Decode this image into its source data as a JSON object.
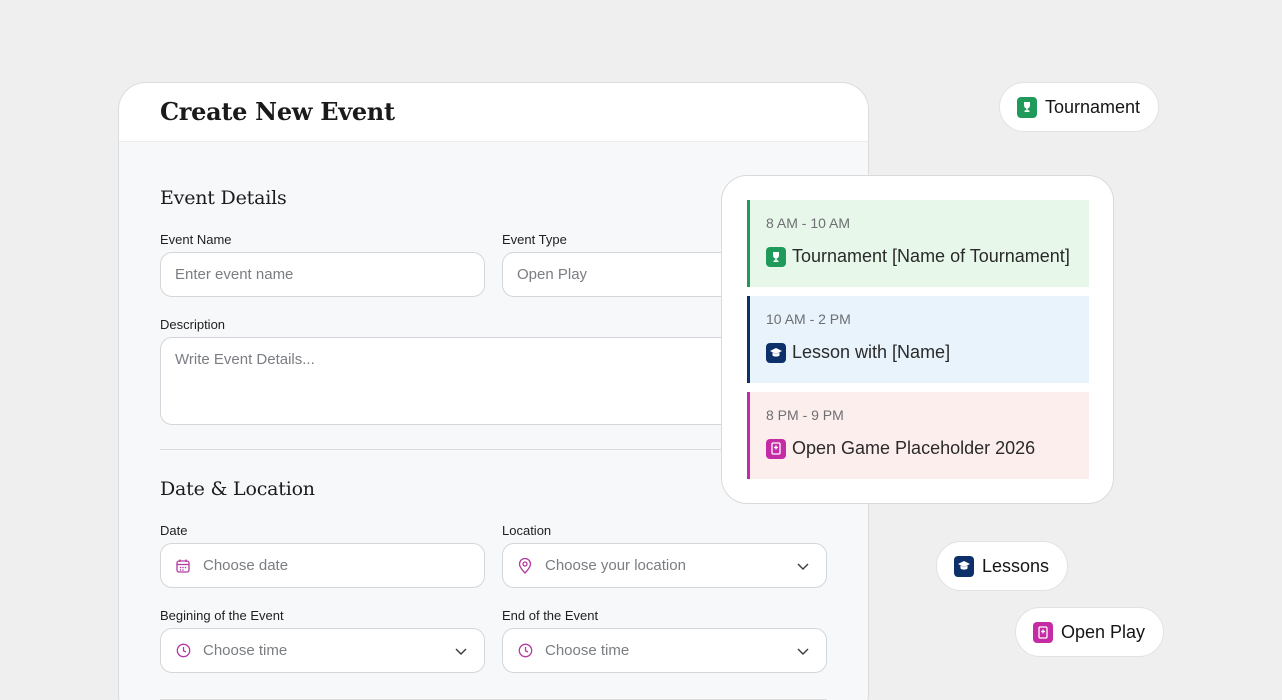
{
  "form": {
    "title": "Create New Event",
    "details": {
      "heading": "Event Details",
      "event_name_label": "Event Name",
      "event_name_placeholder": "Enter event name",
      "event_type_label": "Event Type",
      "event_type_value": "Open Play",
      "description_label": "Description",
      "description_placeholder": "Write Event Details..."
    },
    "date_location": {
      "heading": "Date & Location",
      "date_label": "Date",
      "date_placeholder": "Choose date",
      "location_label": "Location",
      "location_placeholder": "Choose your location",
      "begin_label": "Begining of the Event",
      "begin_placeholder": "Choose time",
      "end_label": "End of the Event",
      "end_placeholder": "Choose time"
    }
  },
  "schedule": [
    {
      "time": "8 AM - 10 AM",
      "name": "Tournament [Name of Tournament]",
      "type": "tournament",
      "bg": "#e7f8ea",
      "accent": "#1f9a5a"
    },
    {
      "time": "10 AM - 2 PM",
      "name": "Lesson with [Name]",
      "type": "lesson",
      "bg": "#e8f3fc",
      "accent": "#0d2f6a"
    },
    {
      "time": "8 PM - 9 PM",
      "name": "Open Game Placeholder 2026",
      "type": "openplay",
      "bg": "#fdeeee",
      "accent": "#c42ba4"
    }
  ],
  "pills": {
    "tournament": "Tournament",
    "lessons": "Lessons",
    "open_play": "Open Play"
  },
  "colors": {
    "tournament": "#1f9a5a",
    "lesson": "#0d2f6a",
    "openplay": "#c42ba4",
    "icon_accent": "#b23aa0"
  },
  "icons": {
    "tournament": "trophy-icon",
    "lesson": "graduation-cap-icon",
    "openplay": "game-card-icon",
    "date": "calendar-icon",
    "location": "map-pin-icon",
    "time": "clock-icon",
    "dropdown": "chevron-down-icon"
  }
}
